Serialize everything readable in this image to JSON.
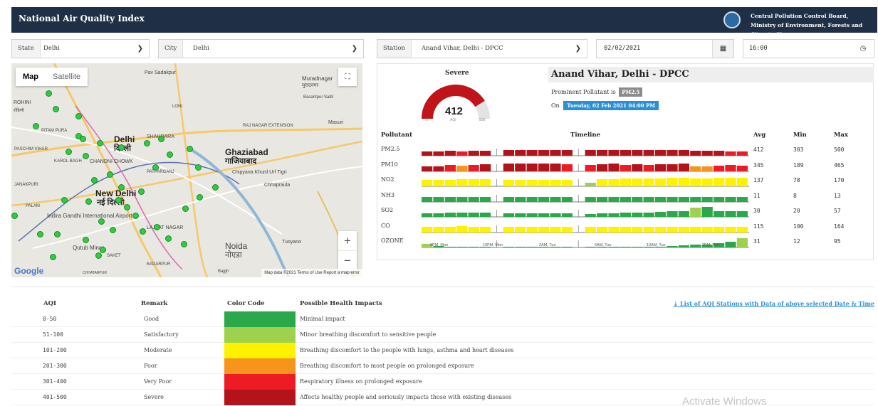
{
  "header": {
    "title": "National Air Quality Index",
    "org_line1": "Central Pollution Control Board,",
    "org_line2": "Ministry of Environment, Forests and Climate Change"
  },
  "filters": {
    "state_label": "State",
    "state_value": "Delhi",
    "city_label": "City",
    "city_value": "Delhi",
    "station_label": "Station",
    "station_value": "Anand Vihar, Delhi - DPCC",
    "date_value": "02/02/2021",
    "time_value": "16:00"
  },
  "map": {
    "tab_map": "Map",
    "tab_satellite": "Satellite",
    "zoom_in": "+",
    "zoom_out": "−",
    "attribution": "Map data ©2021   Terms of Use   Report a map error",
    "google": "Google",
    "labels": [
      {
        "text": "Delhi",
        "size": 12,
        "bold": true
      },
      {
        "text": "दिल्ली",
        "size": 11,
        "bold": true
      },
      {
        "text": "New Delhi",
        "size": 12,
        "bold": true
      },
      {
        "text": "नई दिल्ली",
        "size": 11,
        "bold": true
      },
      {
        "text": "Ghaziabad",
        "size": 12,
        "bold": true
      },
      {
        "text": "गाजियाबाद",
        "size": 11,
        "bold": true
      },
      {
        "text": "Noida",
        "size": 12,
        "bold": false
      },
      {
        "text": "नोएडा",
        "size": 11,
        "bold": false
      },
      {
        "text": "Muradnagar",
        "size": 8,
        "bold": false
      },
      {
        "text": "मुरादनगर",
        "size": 7,
        "bold": false
      },
      {
        "text": "ROHINI",
        "size": 7,
        "bold": false
      },
      {
        "text": "रोहिणी",
        "size": 6,
        "bold": false
      },
      {
        "text": "SHAHDARA",
        "size": 7,
        "bold": false
      },
      {
        "text": "PITAM PURA",
        "size": 6,
        "bold": false
      },
      {
        "text": "PASCHIM VIHAR",
        "size": 6,
        "bold": false
      },
      {
        "text": "CHANDNI CHOWK",
        "size": 7,
        "bold": false
      },
      {
        "text": "KAROL BAGH",
        "size": 6,
        "bold": false
      },
      {
        "text": "PATPARGANJ",
        "size": 6,
        "bold": false
      },
      {
        "text": "Chipyana Khurd Urf Tigri",
        "size": 7,
        "bold": false
      },
      {
        "text": "Chhapraula",
        "size": 7,
        "bold": false
      },
      {
        "text": "Indira Gandhi International Airport",
        "size": 8,
        "bold": false
      },
      {
        "text": "Qutub Minar",
        "size": 8,
        "bold": false
      },
      {
        "text": "Tuoyano",
        "size": 7,
        "bold": false
      },
      {
        "text": "Masuri",
        "size": 7,
        "bold": false
      },
      {
        "text": "Pav Sadakpur",
        "size": 7,
        "bold": false
      },
      {
        "text": "LONI",
        "size": 6,
        "bold": false
      },
      {
        "text": "Basantpur Saitli",
        "size": 6,
        "bold": false
      },
      {
        "text": "RAJ NAGAR EXTENSION",
        "size": 6,
        "bold": false
      },
      {
        "text": "PALAM",
        "size": 6,
        "bold": false
      },
      {
        "text": "JANAKPURI",
        "size": 6,
        "bold": false
      },
      {
        "text": "LAJPAT NAGAR",
        "size": 7,
        "bold": false
      },
      {
        "text": "SAKET",
        "size": 6,
        "bold": false
      },
      {
        "text": "BADARPUR",
        "size": 6,
        "bold": false
      },
      {
        "text": "CHHATARPUR",
        "size": 5,
        "bold": false
      },
      {
        "text": "Bajgh",
        "size": 6,
        "bold": false
      }
    ]
  },
  "aqi": {
    "category": "Severe",
    "value": "412",
    "min_label": "0",
    "max_label": "500",
    "unit": "AQI",
    "fraction": 0.824,
    "color": "#c0141a",
    "station_name": "Anand Vihar, Delhi - DPCC",
    "prominent_text": "Prominent Pollutant is",
    "prominent_value": "PM2.5",
    "on_text": "On",
    "datetime": "Tuesday, 02 Feb 2021 04:00 PM"
  },
  "pollutant_table": {
    "col_pollutant": "Pollutant",
    "col_timeline": "Timeline",
    "col_avg": "Avg",
    "col_min": "Min",
    "col_max": "Max",
    "time_labels": [
      "6PM, Mon",
      "10PM, Mon",
      "2AM, Tue",
      "6AM, Tue",
      "10AM, Tue",
      "2PM, Tue"
    ],
    "rows": [
      {
        "name": "PM2.5",
        "avg": "412",
        "min": "303",
        "max": "500"
      },
      {
        "name": "PM10",
        "avg": "345",
        "min": "189",
        "max": "465"
      },
      {
        "name": "NO2",
        "avg": "137",
        "min": "78",
        "max": "170"
      },
      {
        "name": "NH3",
        "avg": "11",
        "min": "8",
        "max": "13"
      },
      {
        "name": "SO2",
        "avg": "30",
        "min": "20",
        "max": "57"
      },
      {
        "name": "CO",
        "avg": "115",
        "min": "100",
        "max": "164"
      },
      {
        "name": "OZONE",
        "avg": "31",
        "min": "12",
        "max": "95"
      }
    ]
  },
  "legend": {
    "col_aqi": "AQI",
    "col_remark": "Remark",
    "col_color": "Color Code",
    "col_impacts": "Possible Health Impacts",
    "link": "⤓ List of AQI Stations with Data of above selected Date & Time",
    "rows": [
      {
        "range": "0-50",
        "remark": "Good",
        "color": "#2ba84a",
        "impact": "Minimal impact"
      },
      {
        "range": "51-100",
        "remark": "Satisfactory",
        "color": "#9ed14d",
        "impact": "Minor breathing discomfort to sensitive people"
      },
      {
        "range": "101-200",
        "remark": "Moderate",
        "color": "#fff200",
        "impact": "Breathing discomfort to the people with lungs, asthma and heart diseases"
      },
      {
        "range": "201-300",
        "remark": "Poor",
        "color": "#f7941d",
        "impact": "Breathing discomfort to most people on prolonged exposure"
      },
      {
        "range": "301-400",
        "remark": "Very Poor",
        "color": "#ed1c24",
        "impact": "Respiratory illness on prolonged exposure"
      },
      {
        "range": "401-500",
        "remark": "Severe",
        "color": "#b3131a",
        "impact": "Affects healthy people and seriously impacts those with existing diseases"
      }
    ]
  },
  "watermark": "Activate Windows"
}
